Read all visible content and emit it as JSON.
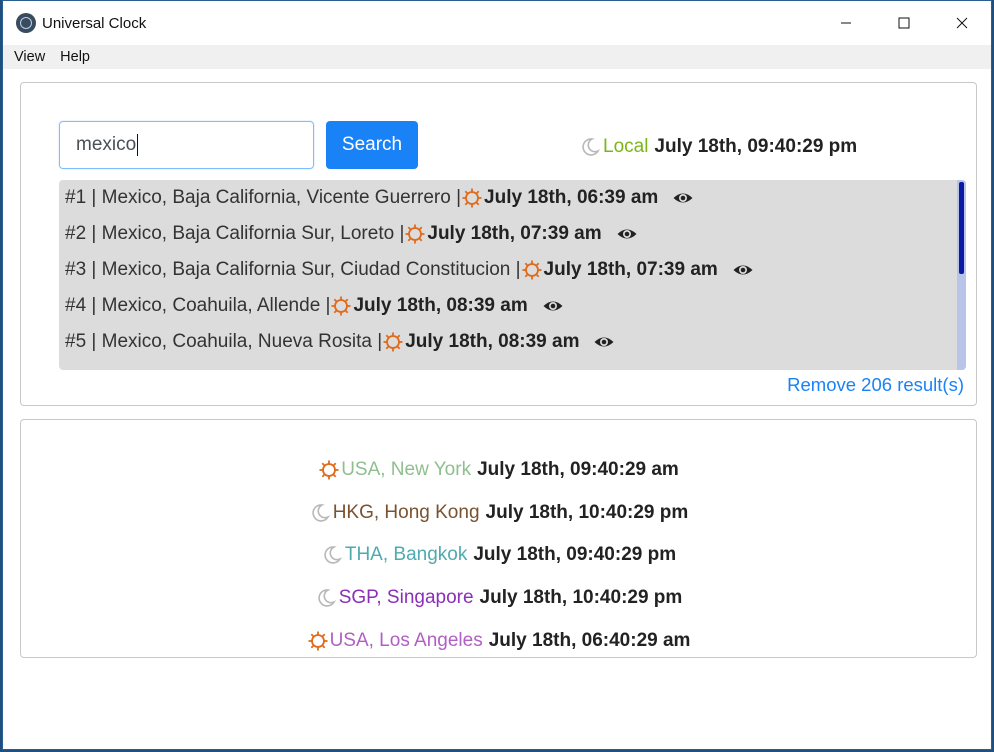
{
  "window": {
    "title": "Universal Clock",
    "controls": {
      "minimize": "—",
      "maximize": "☐",
      "close": "✕"
    }
  },
  "menu": [
    "View",
    "Help"
  ],
  "search": {
    "value": "mexico",
    "button_label": "Search"
  },
  "local_clock": {
    "icon": "moon-icon",
    "label": "Local",
    "time": "July 18th, 09:40:29 pm",
    "label_color": "#7cb518"
  },
  "results": [
    {
      "prefix": "#1 | Mexico, Baja California, Vicente Guerrero |",
      "icon": "sun-icon",
      "time": "July 18th, 06:39 am"
    },
    {
      "prefix": "#2 | Mexico, Baja California Sur, Loreto |",
      "icon": "sun-icon",
      "time": "July 18th, 07:39 am"
    },
    {
      "prefix": "#3 | Mexico, Baja California Sur, Ciudad Constitucion |",
      "icon": "sun-icon",
      "time": "July 18th, 07:39 am"
    },
    {
      "prefix": "#4 | Mexico, Coahuila, Allende |",
      "icon": "sun-icon",
      "time": "July 18th, 08:39 am"
    },
    {
      "prefix": "#5 | Mexico, Coahuila, Nueva Rosita |",
      "icon": "sun-icon",
      "time": "July 18th, 08:39 am"
    }
  ],
  "remove_link": "Remove 206 result(s)",
  "world_clocks": [
    {
      "icon": "sun-icon",
      "label": "USA, New York",
      "time": "July 18th, 09:40:29 am",
      "color": "#8fbf8f"
    },
    {
      "icon": "moon-icon",
      "label": "HKG, Hong Kong",
      "time": "July 18th, 10:40:29 pm",
      "color": "#7a5230"
    },
    {
      "icon": "moon-icon",
      "label": "THA, Bangkok",
      "time": "July 18th, 09:40:29 pm",
      "color": "#4faab0"
    },
    {
      "icon": "moon-icon",
      "label": "SGP, Singapore",
      "time": "July 18th, 10:40:29 pm",
      "color": "#8a2fb8"
    },
    {
      "icon": "sun-icon",
      "label": "USA, Los Angeles",
      "time": "July 18th, 06:40:29 am",
      "color": "#b15fc4"
    }
  ],
  "colors": {
    "accent": "#1a82f7",
    "sun": "#e06a1a",
    "moon": "#b8b8b8",
    "results_bg": "#dcdcdc",
    "scroll_thumb": "#0b1aa5"
  }
}
